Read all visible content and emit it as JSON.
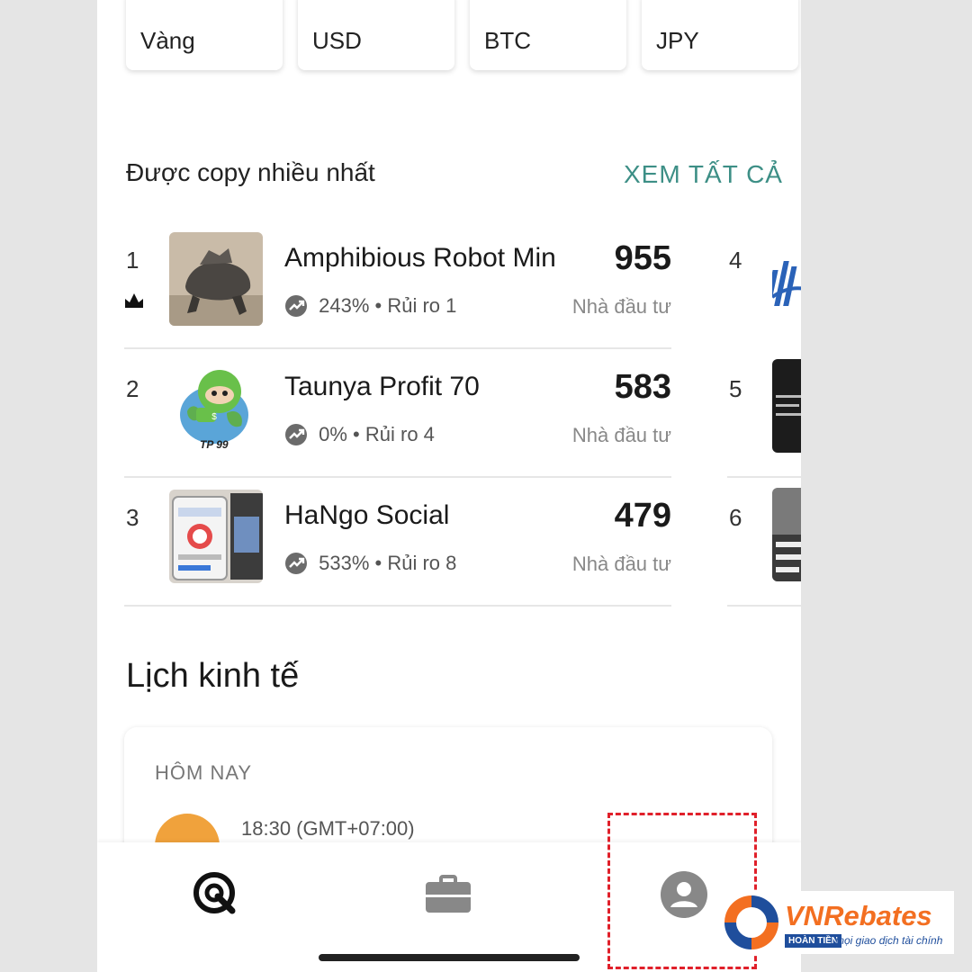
{
  "assets": [
    "Vàng",
    "USD",
    "BTC",
    "JPY"
  ],
  "most_copied": {
    "title": "Được copy nhiều nhất",
    "see_all": "XEM TẤT CẢ",
    "traders": [
      {
        "rank": "1",
        "name": "Amphibious Robot Min",
        "count": "955",
        "gain": "243%",
        "separator": "•",
        "risk": "Rủi ro 1",
        "investors_label": "Nhà đầu tư"
      },
      {
        "rank": "2",
        "name": "Taunya Profit 70",
        "count": "583",
        "gain": "0%",
        "separator": "•",
        "risk": "Rủi ro 4",
        "investors_label": "Nhà đầu tư"
      },
      {
        "rank": "3",
        "name": "HaNgo Social",
        "count": "479",
        "gain": "533%",
        "separator": "•",
        "risk": "Rủi ro 8",
        "investors_label": "Nhà đầu tư"
      }
    ],
    "traders_right": [
      {
        "rank": "4"
      },
      {
        "rank": "5"
      },
      {
        "rank": "6"
      }
    ],
    "thumb_text": {
      "tp99": "TP 99"
    }
  },
  "economic_calendar": {
    "title": "Lịch kinh tế",
    "day_label": "HÔM NAY",
    "event_time": "18:30 (GMT+07:00)"
  },
  "tabbar": {
    "items": [
      "discover-icon",
      "portfolio-icon",
      "profile-icon"
    ]
  },
  "brand": {
    "name": "VNRebates",
    "badge": "HOÀN TIỀN",
    "tagline": "mọi giao dịch tài chính",
    "colors": {
      "orange": "#f36f21",
      "blue": "#1f4e9c"
    }
  },
  "colors": {
    "accent": "#3d8f86",
    "highlight": "#e0202a"
  }
}
